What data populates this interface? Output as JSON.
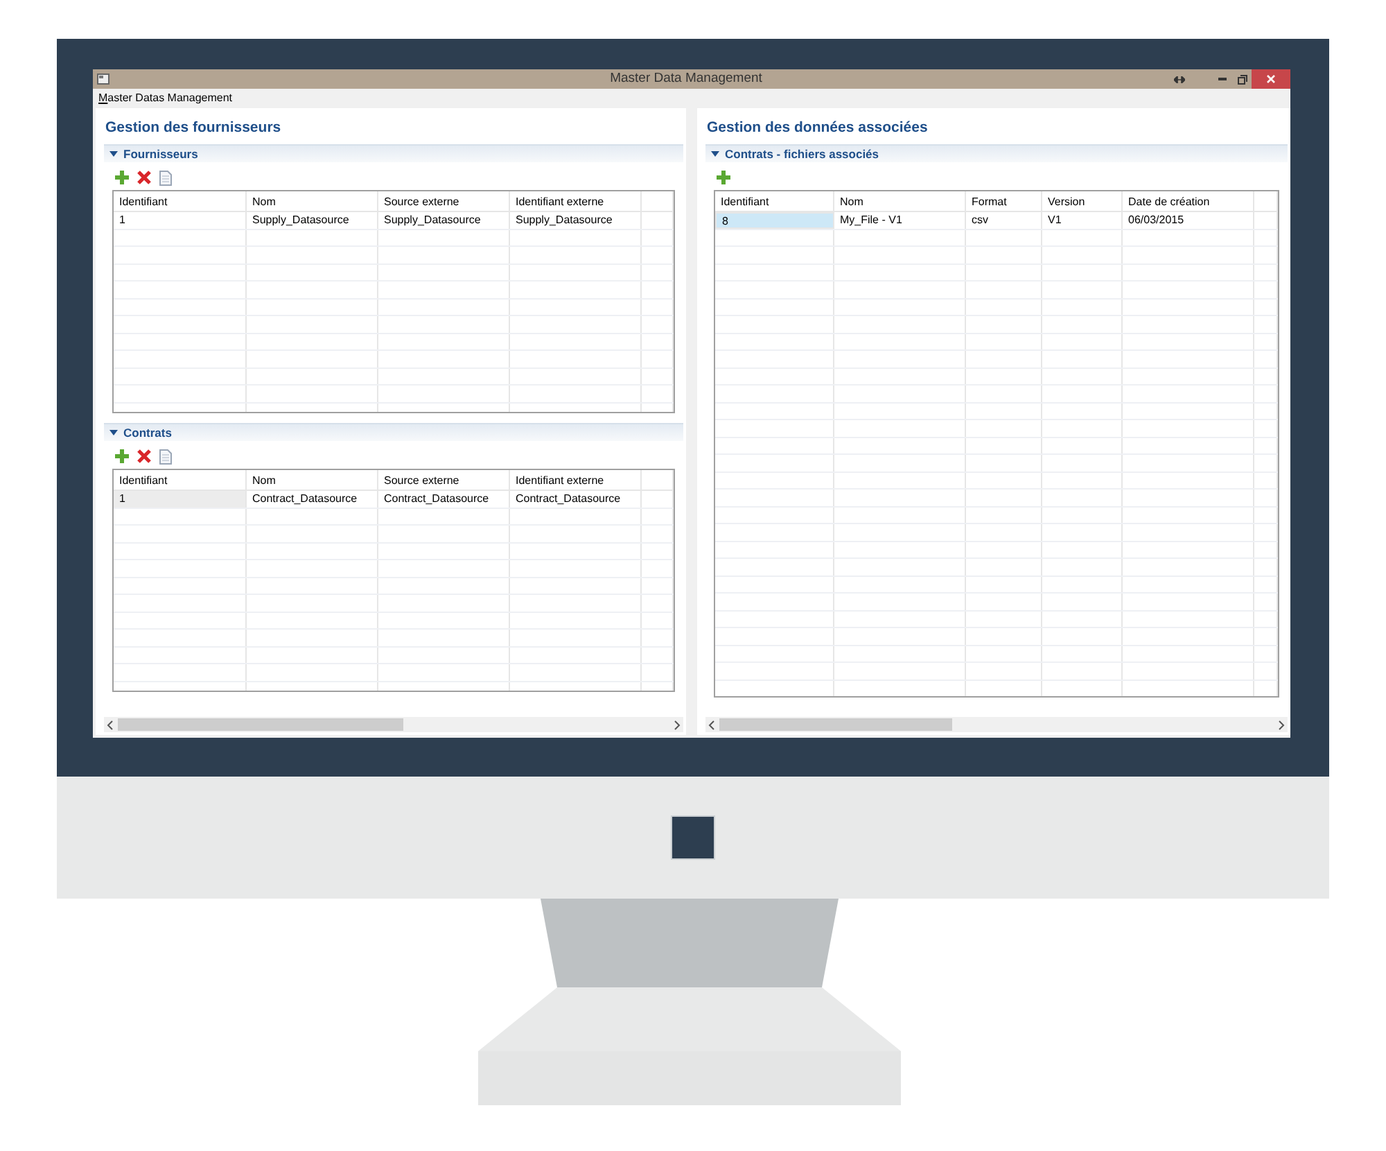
{
  "window": {
    "title": "Master Data Management",
    "menu": [
      {
        "label": "Master Datas Management"
      }
    ]
  },
  "left": {
    "heading": "Gestion des fournisseurs",
    "focused": false,
    "sections": [
      {
        "title": "Fournisseurs",
        "expanded": true,
        "toolbar": [
          {
            "kind": "add"
          },
          {
            "kind": "delete"
          },
          {
            "kind": "document"
          }
        ],
        "columns": [
          "Identifiant",
          "Nom",
          "Source externe",
          "Identifiant externe"
        ],
        "rows": [
          {
            "cells": [
              "1",
              "Supply_Datasource",
              "Supply_Datasource",
              "Supply_Datasource"
            ],
            "selected": false
          }
        ]
      },
      {
        "title": "Contrats",
        "expanded": true,
        "toolbar": [
          {
            "kind": "add"
          },
          {
            "kind": "delete"
          },
          {
            "kind": "document"
          }
        ],
        "columns": [
          "Identifiant",
          "Nom",
          "Source externe",
          "Identifiant externe"
        ],
        "rows": [
          {
            "cells": [
              "1",
              "Contract_Datasource",
              "Contract_Datasource",
              "Contract_Datasource"
            ],
            "selected": true
          }
        ]
      }
    ]
  },
  "right": {
    "heading": "Gestion des données associées",
    "focused": true,
    "sections": [
      {
        "title": "Contrats - fichiers associés",
        "expanded": true,
        "toolbar": [
          {
            "kind": "add"
          }
        ],
        "columns": [
          "Identifiant",
          "Nom",
          "Format",
          "Version",
          "Date de création"
        ],
        "rows": [
          {
            "cells": [
              "8",
              "My_File - V1",
              "csv",
              "V1",
              "06/03/2015"
            ],
            "selected": true
          }
        ]
      }
    ]
  }
}
